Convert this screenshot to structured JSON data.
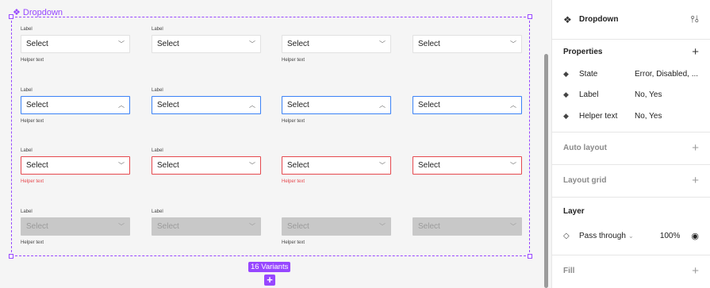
{
  "component": {
    "name": "Dropdown",
    "icon": "component-icon"
  },
  "grid": {
    "rows": [
      {
        "state": "default",
        "cells": [
          {
            "label": "Label",
            "value": "Select",
            "helper": "Helper text"
          },
          {
            "label": "Label",
            "value": "Select",
            "helper": ""
          },
          {
            "label": "",
            "value": "Select",
            "helper": "Helper text"
          },
          {
            "label": "",
            "value": "Select",
            "helper": ""
          }
        ]
      },
      {
        "state": "focused",
        "cells": [
          {
            "label": "Label",
            "value": "Select",
            "helper": "Helper text"
          },
          {
            "label": "Label",
            "value": "Select",
            "helper": ""
          },
          {
            "label": "",
            "value": "Select",
            "helper": "Helper text"
          },
          {
            "label": "",
            "value": "Select",
            "helper": ""
          }
        ]
      },
      {
        "state": "error",
        "cells": [
          {
            "label": "Label",
            "value": "Select",
            "helper": "Helper text"
          },
          {
            "label": "Label",
            "value": "Select",
            "helper": ""
          },
          {
            "label": "",
            "value": "Select",
            "helper": "Helper text"
          },
          {
            "label": "",
            "value": "Select",
            "helper": ""
          }
        ]
      },
      {
        "state": "disabled",
        "cells": [
          {
            "label": "Label",
            "value": "Select",
            "helper": "Helper text"
          },
          {
            "label": "Label",
            "value": "Select",
            "helper": ""
          },
          {
            "label": "",
            "value": "Select",
            "helper": "Helper text"
          },
          {
            "label": "",
            "value": "Select",
            "helper": ""
          }
        ]
      }
    ]
  },
  "variants_badge": "16 Variants",
  "add_variant_symbol": "+",
  "panel": {
    "title": "Dropdown",
    "properties": {
      "title": "Properties",
      "items": [
        {
          "name": "State",
          "value": "Error, Disabled, ..."
        },
        {
          "name": "Label",
          "value": "No, Yes"
        },
        {
          "name": "Helper text",
          "value": "No, Yes"
        }
      ]
    },
    "auto_layout": "Auto layout",
    "layout_grid": "Layout grid",
    "layer": {
      "title": "Layer",
      "blend_mode": "Pass through",
      "opacity": "100%"
    },
    "fill": "Fill"
  },
  "colors": {
    "accent": "#9747ff",
    "focus": "#3b82f6",
    "error": "#e5484d",
    "disabled": "#c8c8c8"
  }
}
